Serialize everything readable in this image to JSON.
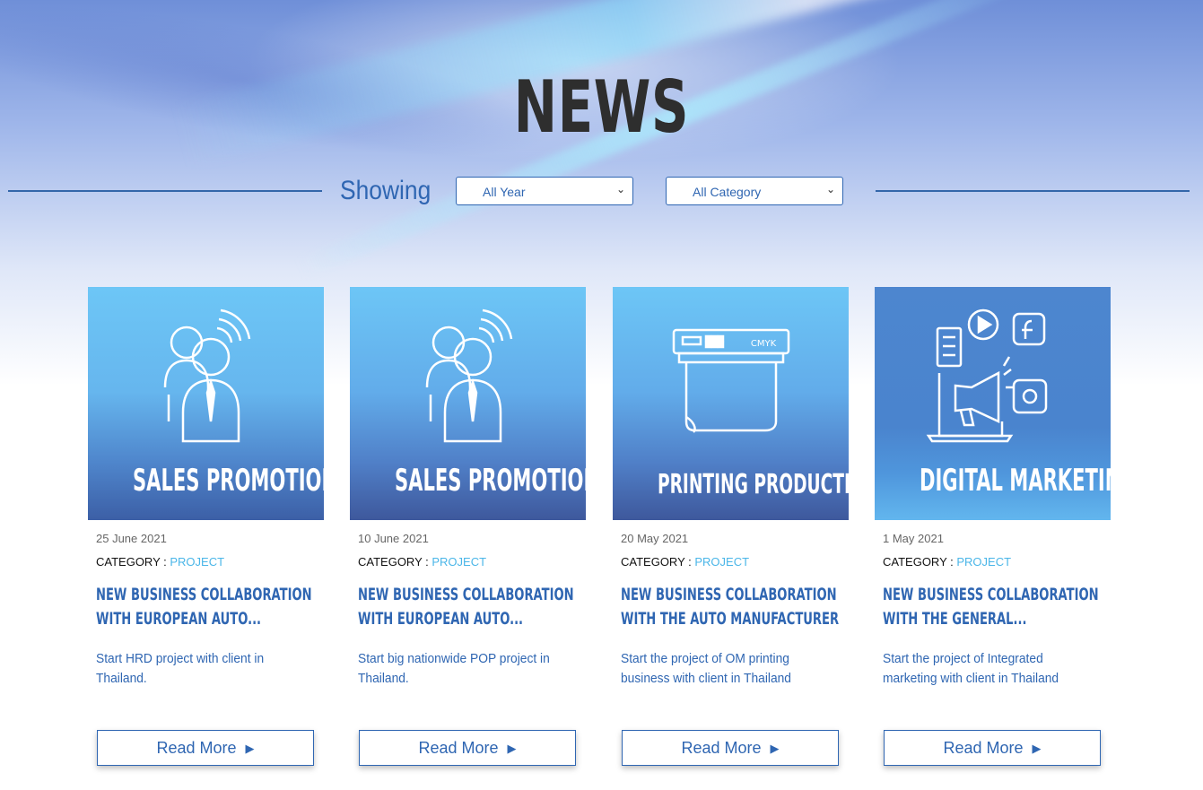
{
  "page": {
    "title": "NEWS"
  },
  "filters": {
    "showing_label": "Showing",
    "year_selected": "All Year",
    "category_selected": "All Category"
  },
  "cards": [
    {
      "image_label": "SALES PROMOTION TOOLS",
      "image_icon": "people-signal-icon",
      "date": "25  June  2021",
      "category_label": "CATEGORY  :",
      "category_value": "PROJECT",
      "headline": "NEW BUSINESS COLLABORATION WITH EUROPEAN AUTO...",
      "excerpt": "Start HRD project with client in Thailand.",
      "button_label": "Read More"
    },
    {
      "image_label": "SALES PROMOTION TOOLS",
      "image_icon": "people-signal-icon",
      "date": "10  June  2021",
      "category_label": "CATEGORY  :",
      "category_value": "PROJECT",
      "headline": "NEW BUSINESS COLLABORATION WITH EUROPEAN AUTO...",
      "excerpt": "Start big nationwide POP project in Thailand.",
      "button_label": "Read More"
    },
    {
      "image_label": "PRINTING PRODUCTION",
      "image_icon": "printer-icon",
      "image_icon_text": "CMYK",
      "date": "20  May  2021",
      "category_label": "CATEGORY  :",
      "category_value": "PROJECT",
      "headline": "NEW BUSINESS COLLABORATION WITH THE AUTO MANUFACTURER",
      "excerpt": "Start the project of OM printing business with client in Thailand",
      "button_label": "Read More"
    },
    {
      "image_label": "DIGITAL MARKETING",
      "image_icon": "megaphone-social-icon",
      "date": "1  May  2021",
      "category_label": "CATEGORY  :",
      "category_value": "PROJECT",
      "headline": "NEW BUSINESS COLLABORATION WITH THE GENERAL...",
      "excerpt": "Start the project of Integrated marketing with client in Thailand",
      "button_label": "Read More"
    }
  ]
}
